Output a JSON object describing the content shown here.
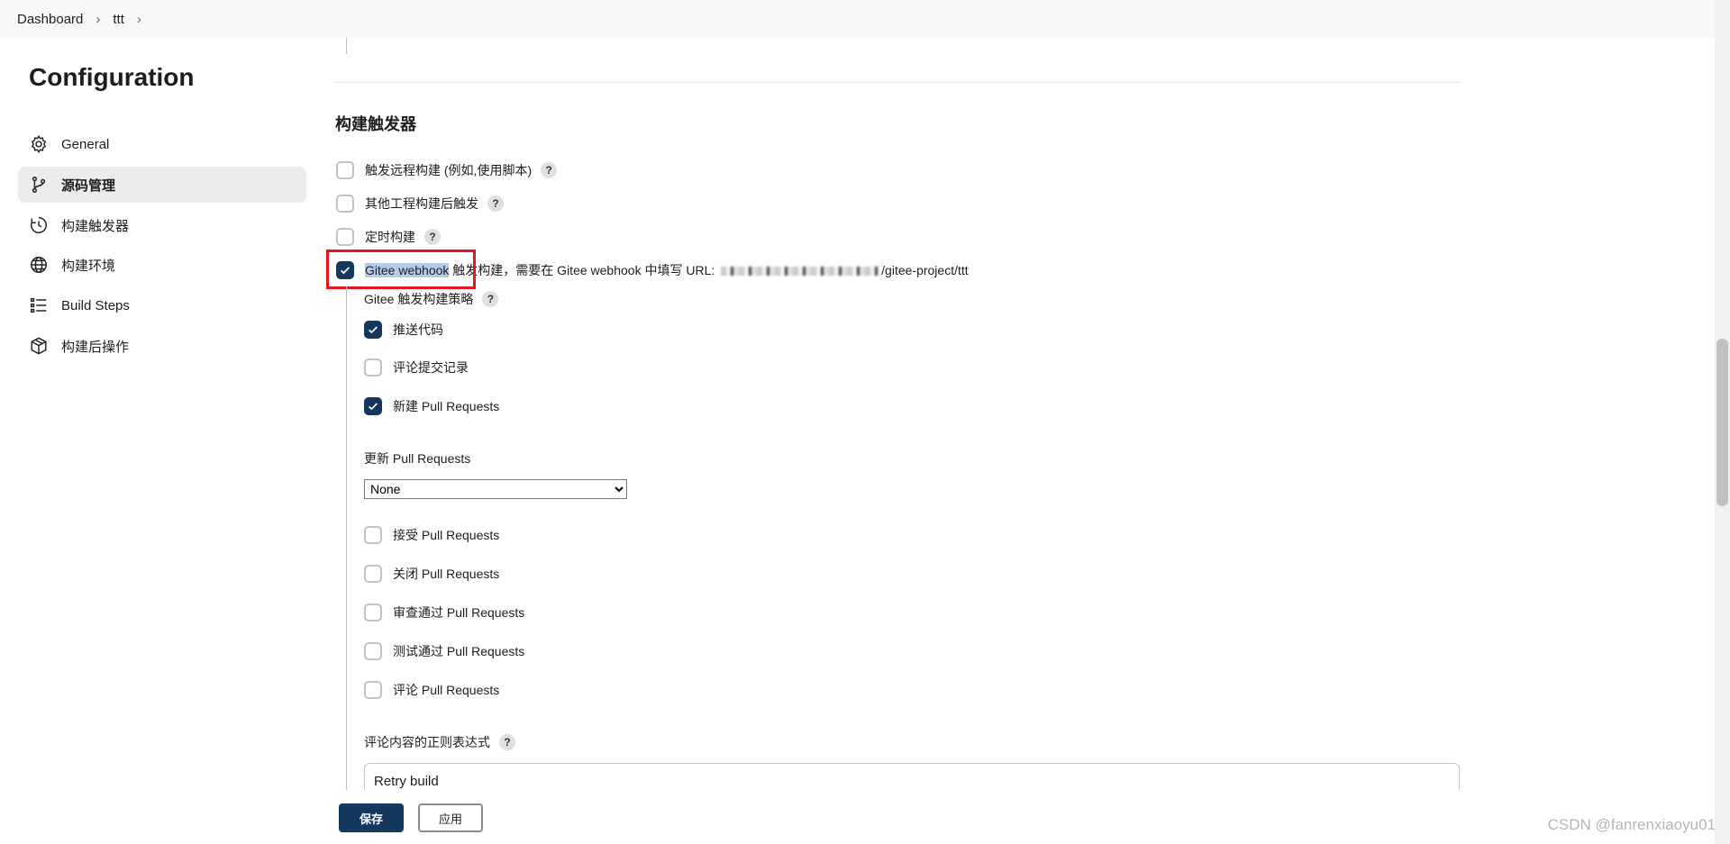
{
  "breadcrumb": [
    "Dashboard",
    "ttt"
  ],
  "sidebar": {
    "title": "Configuration",
    "items": [
      {
        "label": "General",
        "icon": "gear-icon"
      },
      {
        "label": "源码管理",
        "icon": "git-branch-icon",
        "active": true
      },
      {
        "label": "构建触发器",
        "icon": "clock-icon"
      },
      {
        "label": "构建环境",
        "icon": "globe-icon"
      },
      {
        "label": "Build Steps",
        "icon": "list-icon"
      },
      {
        "label": "构建后操作",
        "icon": "package-icon"
      }
    ]
  },
  "triggers": {
    "section_title": "构建触发器",
    "options": [
      {
        "label": "触发远程构建 (例如,使用脚本)",
        "checked": false
      },
      {
        "label": "其他工程构建后触发",
        "checked": false
      },
      {
        "label": "定时构建",
        "checked": false
      }
    ],
    "gitee": {
      "label_highlight": "Gitee webhook",
      "label_rest": " 触发构建，需要在 Gitee webhook 中填写 URL: ",
      "url_suffix": "/gitee-project/ttt",
      "checked": true
    },
    "strategy_label": "Gitee 触发构建策略",
    "strategy_options": [
      {
        "label": "推送代码",
        "checked": true
      },
      {
        "label": "评论提交记录",
        "checked": false
      },
      {
        "label": "新建 Pull Requests",
        "checked": true
      }
    ],
    "update_pr_label": "更新 Pull Requests",
    "update_pr_select": "None",
    "pr_options": [
      {
        "label": "接受 Pull Requests",
        "checked": false
      },
      {
        "label": "关闭 Pull Requests",
        "checked": false
      },
      {
        "label": "审查通过 Pull Requests",
        "checked": false
      },
      {
        "label": "测试通过 Pull Requests",
        "checked": false
      },
      {
        "label": "评论 Pull Requests",
        "checked": false
      }
    ],
    "comment_regex_label": "评论内容的正则表达式",
    "comment_regex_value": "Retry build"
  },
  "help_symbol": "?",
  "buttons": {
    "save": "保存",
    "apply": "应用"
  },
  "watermark": "CSDN @fanrenxiaoyu01",
  "colors": {
    "primary": "#14375e",
    "highlight_box": "#e8141f"
  }
}
